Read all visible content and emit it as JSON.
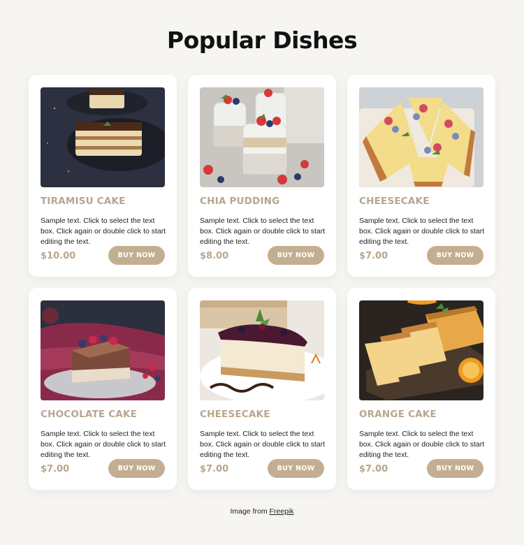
{
  "page": {
    "title": "Popular Dishes",
    "accent_color": "#c4ae92",
    "price_color": "#b9a58c",
    "background": "#f7f5f2"
  },
  "dishes": [
    {
      "name": "TIRAMISU CAKE",
      "description": "Sample text. Click to select the text box. Click again or double click to start editing the text.",
      "price": "$10.00",
      "button_label": "BUY NOW"
    },
    {
      "name": "CHIA PUDDING",
      "description": "Sample text. Click to select the text box. Click again or double click to start editing the text.",
      "price": "$8.00",
      "button_label": "BUY NOW"
    },
    {
      "name": "CHEESECAKE",
      "description": "Sample text. Click to select the text box. Click again or double click to start editing the text.",
      "price": "$7.00",
      "button_label": "BUY NOW"
    },
    {
      "name": "CHOCOLATE CAKE",
      "description": "Sample text. Click to select the text box. Click again or double click to start editing the text.",
      "price": "$7.00",
      "button_label": "BUY NOW"
    },
    {
      "name": "CHEESECAKE",
      "description": "Sample text. Click to select the text box. Click again or double click to start editing the text.",
      "price": "$7.00",
      "button_label": "BUY NOW"
    },
    {
      "name": "ORANGE CAKE",
      "description": "Sample text. Click to select the text box. Click again or double click to start editing the text.",
      "price": "$7.00",
      "button_label": "BUY NOW"
    }
  ],
  "footer": {
    "credit_prefix": "Image from",
    "credit_link": "Freepik"
  }
}
